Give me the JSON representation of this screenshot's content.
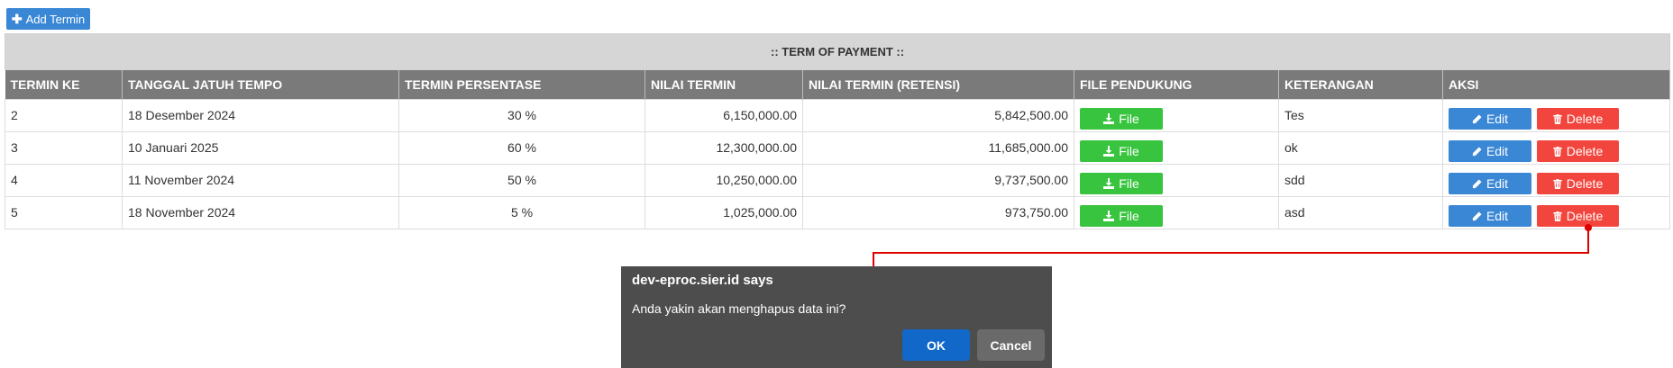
{
  "toolbar": {
    "add_label": "Add Termin",
    "add_icon": "plus-icon"
  },
  "table": {
    "caption": ":: TERM OF PAYMENT ::",
    "headers": [
      "TERMIN KE",
      "TANGGAL JATUH TEMPO",
      "TERMIN PERSENTASE",
      "NILAI TERMIN",
      "NILAI TERMIN (RETENSI)",
      "FILE PENDUKUNG",
      "KETERANGAN",
      "AKSI"
    ],
    "rows": [
      {
        "termin": "2",
        "tanggal": "18 Desember 2024",
        "persentase": "30 %",
        "nilai": "6,150,000.00",
        "retensi": "5,842,500.00",
        "keterangan": "Tes"
      },
      {
        "termin": "3",
        "tanggal": "10 Januari 2025",
        "persentase": "60 %",
        "nilai": "12,300,000.00",
        "retensi": "11,685,000.00",
        "keterangan": "ok"
      },
      {
        "termin": "4",
        "tanggal": "11 November 2024",
        "persentase": "50 %",
        "nilai": "10,250,000.00",
        "retensi": "9,737,500.00",
        "keterangan": "sdd"
      },
      {
        "termin": "5",
        "tanggal": "18 November 2024",
        "persentase": "5 %",
        "nilai": "1,025,000.00",
        "retensi": "973,750.00",
        "keterangan": "asd"
      }
    ],
    "file_label": "File",
    "edit_label": "Edit",
    "delete_label": "Delete"
  },
  "dialog": {
    "title": "dev-eproc.sier.id says",
    "message": "Anda yakin akan menghapus data ini?",
    "ok_label": "OK",
    "cancel_label": "Cancel"
  },
  "colors": {
    "primary": "#3a87d6",
    "success": "#39c43f",
    "danger": "#f2453d",
    "header_bg": "#7a7a7a",
    "caption_bg": "#d6d6d6",
    "dialog_bg": "#4d4d4d",
    "dialog_ok": "#1168c8",
    "annotation_arrow": "#e00000"
  }
}
